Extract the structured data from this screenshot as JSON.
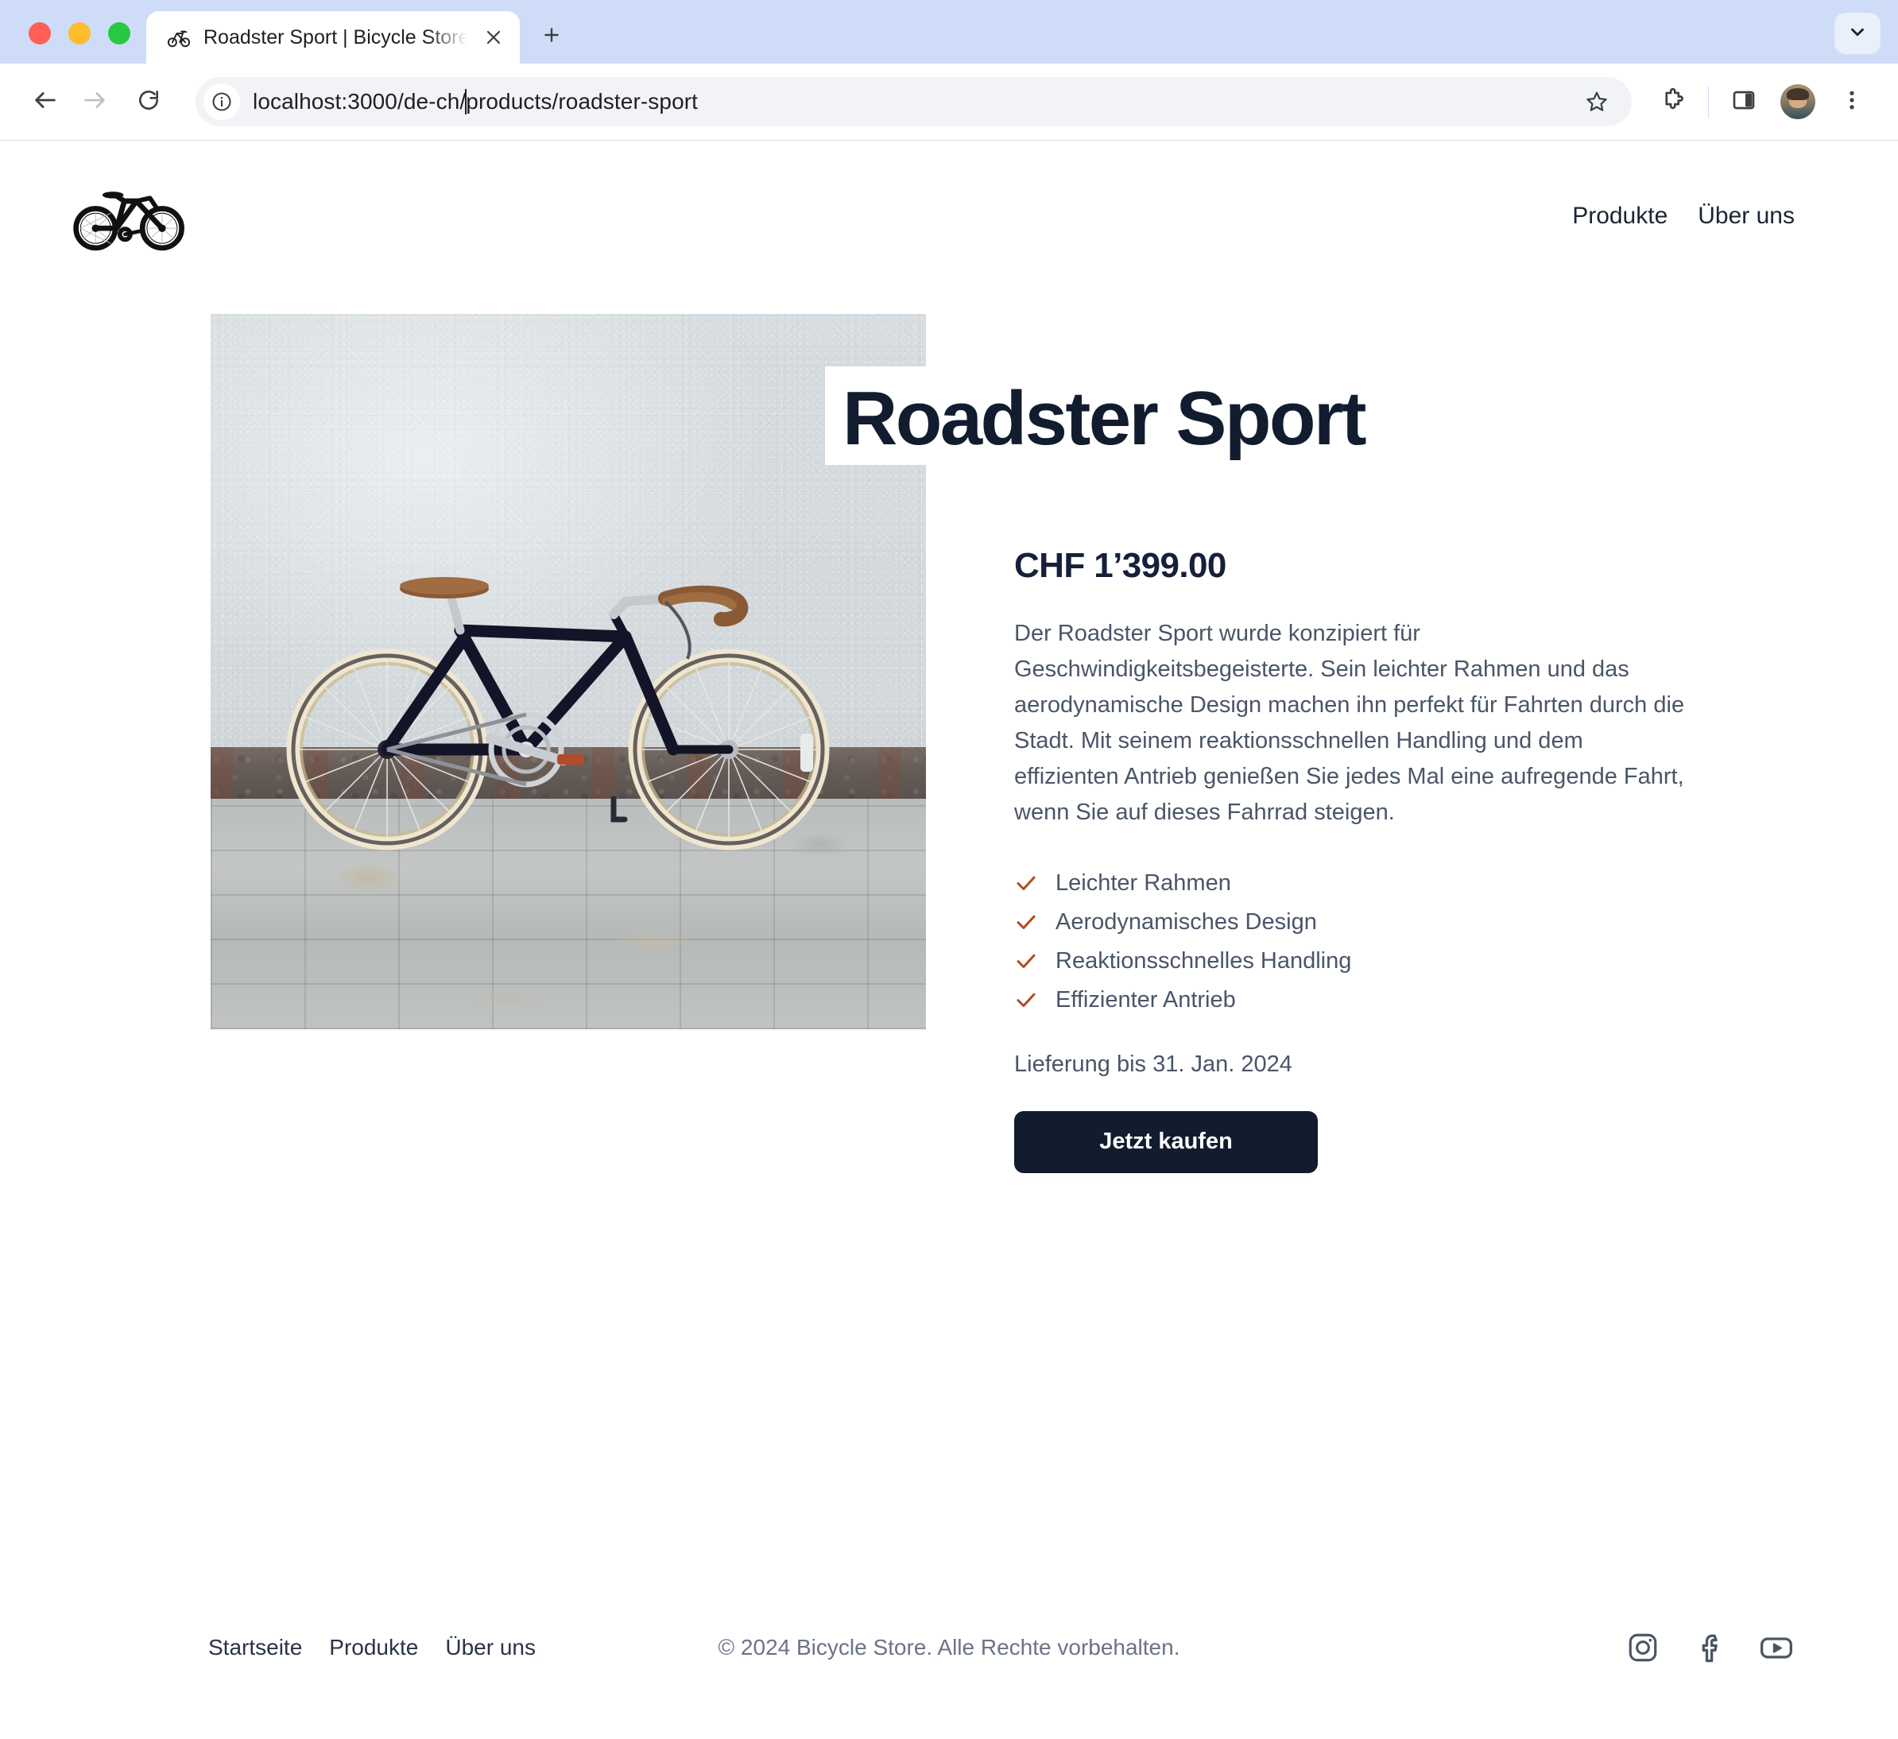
{
  "browser": {
    "tab": {
      "title": "Roadster Sport | Bicycle Store",
      "favicon_name": "bicycle-favicon",
      "close_label": "×"
    },
    "new_tab_label": "+",
    "tab_list_icon": "chevron-down-icon",
    "toolbar": {
      "back_icon": "back-arrow-icon",
      "forward_icon": "forward-arrow-icon",
      "reload_icon": "reload-icon",
      "site_info_icon": "info-circle-icon",
      "url": "localhost:3000/de-ch/products/roadster-sport",
      "url_before_caret": "localhost:3000/de-ch/",
      "url_after_caret": "products/roadster-sport",
      "bookmark_icon": "star-icon",
      "extensions_icon": "puzzle-piece-icon",
      "side_panel_icon": "side-panel-icon",
      "profile_icon": "avatar",
      "menu_icon": "three-dot-menu-icon"
    }
  },
  "site": {
    "logo_name": "bicycle-logo",
    "nav": [
      {
        "label": "Produkte"
      },
      {
        "label": "Über uns"
      }
    ]
  },
  "product": {
    "image_alt": "roadster-sport-bicycle-photo",
    "title": "Roadster Sport",
    "price": "CHF 1’399.00",
    "description": "Der Roadster Sport wurde konzipiert für Geschwindigkeitsbegeisterte. Sein leichter Rahmen und das aerodynamische Design machen ihn perfekt für Fahrten durch die Stadt. Mit seinem reaktionsschnellen Handling und dem effizienten Antrieb genießen Sie jedes Mal eine aufregende Fahrt, wenn Sie auf dieses Fahrrad steigen.",
    "features": [
      {
        "label": "Leichter Rahmen"
      },
      {
        "label": "Aerodynamisches Design"
      },
      {
        "label": "Reaktionsschnelles Handling"
      },
      {
        "label": "Effizienter Antrieb"
      }
    ],
    "delivery": "Lieferung bis 31. Jan. 2024",
    "buy_label": "Jetzt kaufen"
  },
  "footer": {
    "links": [
      {
        "label": "Startseite"
      },
      {
        "label": "Produkte"
      },
      {
        "label": "Über uns"
      }
    ],
    "copyright": "© 2024 Bicycle Store. Alle Rechte vorbehalten.",
    "social": [
      {
        "name": "instagram-icon"
      },
      {
        "name": "facebook-icon"
      },
      {
        "name": "youtube-icon"
      }
    ]
  },
  "colors": {
    "accent_check": "#b4491f",
    "title": "#111c2e",
    "button_bg": "#111c2e",
    "chrome_bg": "#cfdcf7",
    "body_text": "#4a5568"
  }
}
